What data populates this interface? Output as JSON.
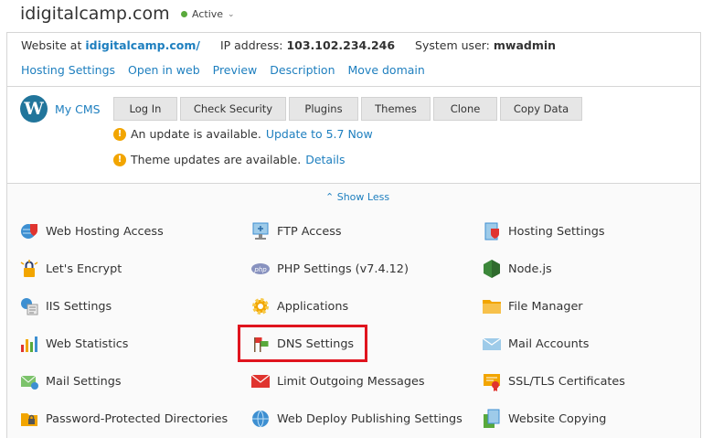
{
  "header": {
    "domain": "idigitalcamp.com",
    "status": "Active",
    "status_color": "#59a93b"
  },
  "info": {
    "website_label": "Website at",
    "website_link": "idigitalcamp.com/",
    "ip_label": "IP address:",
    "ip_value": "103.102.234.246",
    "user_label": "System user:",
    "user_value": "mwadmin"
  },
  "links": [
    "Hosting Settings",
    "Open in web",
    "Preview",
    "Description",
    "Move domain"
  ],
  "cms": {
    "name": "My CMS",
    "buttons": [
      "Log In",
      "Check Security",
      "Plugins",
      "Themes",
      "Clone",
      "Copy Data"
    ],
    "notice1_text": "An update is available.",
    "notice1_link": "Update to 5.7 Now",
    "notice2_text": "Theme updates are available.",
    "notice2_link": "Details"
  },
  "show_less": "Show Less",
  "tools": {
    "col1": [
      "Web Hosting Access",
      "Let's Encrypt",
      "IIS Settings",
      "Web Statistics",
      "Mail Settings",
      "Password-Protected Directories"
    ],
    "col2": [
      "FTP Access",
      "PHP Settings (v7.4.12)",
      "Applications",
      "DNS Settings",
      "Limit Outgoing Messages",
      "Web Deploy Publishing Settings"
    ],
    "col3": [
      "Hosting Settings",
      "Node.js",
      "File Manager",
      "Mail Accounts",
      "SSL/TLS Certificates",
      "Website Copying"
    ]
  },
  "icons": {
    "col1": [
      "globe-shield-icon",
      "lets-encrypt-icon",
      "iis-settings-icon",
      "web-statistics-icon",
      "mail-settings-icon",
      "protected-folder-icon"
    ],
    "col2": [
      "ftp-access-icon",
      "php-icon",
      "applications-gear-icon",
      "dns-flags-icon",
      "limit-mail-icon",
      "web-deploy-globe-icon"
    ],
    "col3": [
      "hosting-settings-icon",
      "nodejs-icon",
      "file-manager-folder-icon",
      "mail-accounts-icon",
      "ssl-certificate-icon",
      "website-copying-icon"
    ]
  },
  "highlight_color": "#e0141e",
  "link_color": "#1e7fbf"
}
